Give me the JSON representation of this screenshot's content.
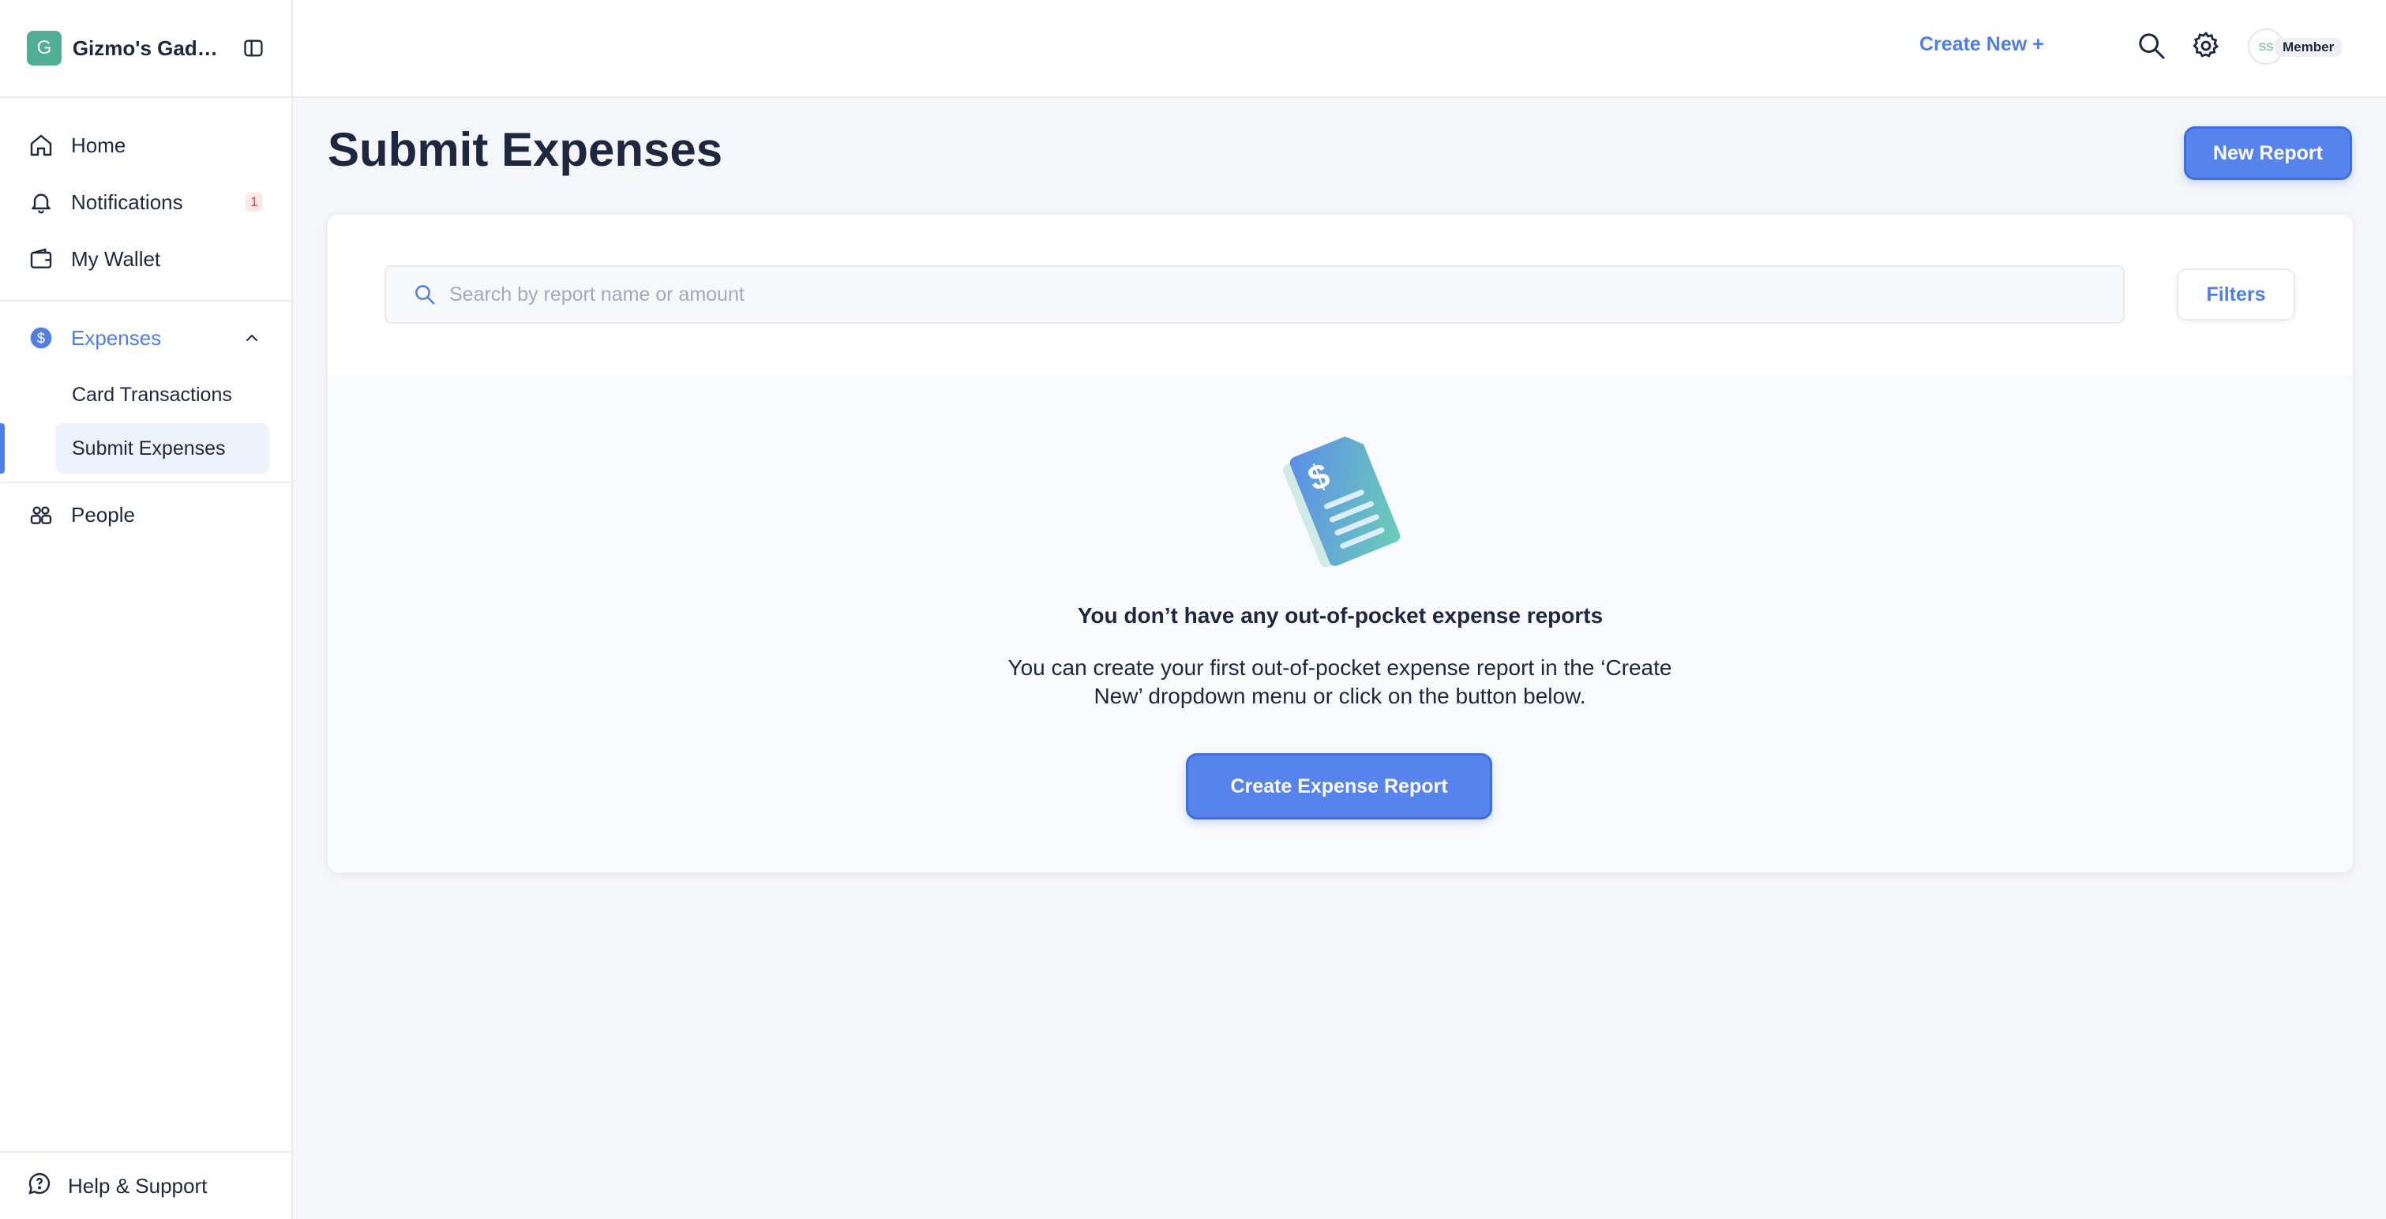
{
  "brand": {
    "logo_letter": "G",
    "name": "Gizmo's Gadgets"
  },
  "nav": {
    "home": "Home",
    "notifications": "Notifications",
    "notifications_count": "1",
    "wallet": "My Wallet",
    "expenses": "Expenses",
    "expenses_sub": [
      "Card Transactions",
      "Submit Expenses"
    ],
    "people": "People",
    "help": "Help & Support"
  },
  "topbar": {
    "create_new": "Create New +",
    "avatar_initials": "SS",
    "role": "Member"
  },
  "page": {
    "title": "Submit Expenses",
    "new_report": "New Report"
  },
  "search": {
    "placeholder": "Search by report name or amount",
    "value": ""
  },
  "filters_label": "Filters",
  "empty_state": {
    "title": "You don’t have any out-of-pocket expense reports",
    "description": "You can create your first out-of-pocket expense report in the ‘Create New’ dropdown menu or click on the button below.",
    "cta": "Create Expense Report"
  },
  "colors": {
    "accent": "#4f7fe6",
    "brand_logo": "#4fae94",
    "badge_text": "#d64545",
    "text": "#1d2740"
  },
  "icons": {
    "home": "home-icon",
    "notifications": "bell-icon",
    "wallet": "wallet-icon",
    "expenses": "dollar-icon",
    "people": "people-icon",
    "help": "help-chat-icon",
    "search": "search-icon",
    "settings": "gear-icon",
    "sidebar_toggle": "sidebar-toggle-icon",
    "collapse": "chevron-up-icon",
    "empty": "receipt-illustration"
  }
}
